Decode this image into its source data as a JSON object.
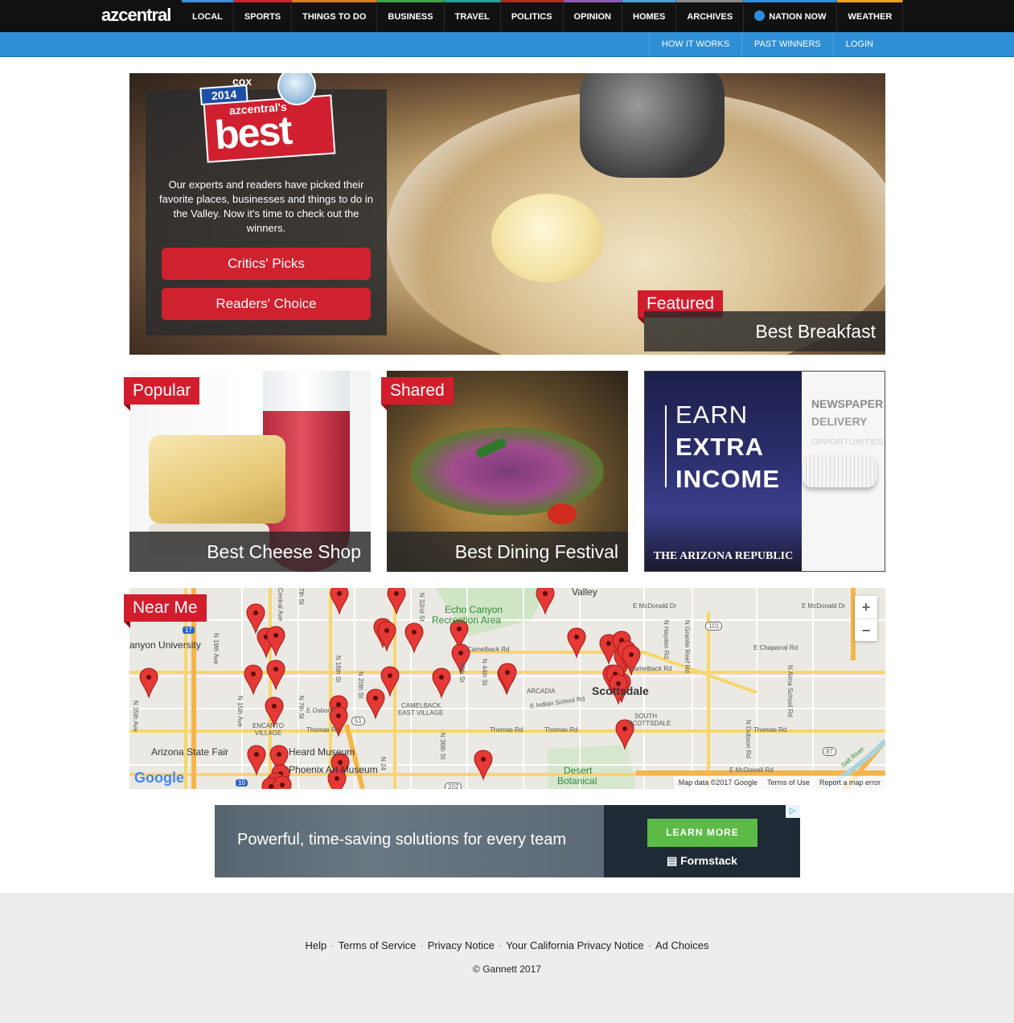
{
  "nav": {
    "logo": "azcentral",
    "items": [
      {
        "label": "LOCAL",
        "color": "#3a8fd8"
      },
      {
        "label": "SPORTS",
        "color": "#d0212f"
      },
      {
        "label": "THINGS TO DO",
        "color": "#e07a1f"
      },
      {
        "label": "BUSINESS",
        "color": "#3aa34a"
      },
      {
        "label": "TRAVEL",
        "color": "#1fa3a0"
      },
      {
        "label": "POLITICS",
        "color": "#b3281f"
      },
      {
        "label": "OPINION",
        "color": "#8a5db3"
      },
      {
        "label": "HOMES",
        "color": "#4aa3d8"
      },
      {
        "label": "ARCHIVES",
        "color": "#8a8a8a"
      },
      {
        "label": "NATION NOW",
        "color": "#2e8fe0"
      },
      {
        "label": "WEATHER",
        "color": "#f0a11f"
      }
    ]
  },
  "subnav": {
    "items": [
      "HOW IT WORKS",
      "PAST WINNERS",
      "LOGIN"
    ]
  },
  "hero": {
    "badge": {
      "sponsor": "cox",
      "year": "2014",
      "brand": "azcentral's",
      "title": "best"
    },
    "blurb": "Our experts and readers have picked their favorite places, businesses and things to do in the Valley. Now it's time to check out the winners.",
    "critics_button": "Critics' Picks",
    "readers_button": "Readers' Choice",
    "featured_tag": "Featured",
    "featured_caption": "Best Breakfast"
  },
  "tiles": {
    "popular_tag": "Popular",
    "popular_caption": "Best Cheese Shop",
    "shared_tag": "Shared",
    "shared_caption": "Best Dining Festival"
  },
  "ad_tile": {
    "line1": "EARN",
    "line2": "EXTRA",
    "line3": "INCOME",
    "publisher": "THE ARIZONA REPUBLIC",
    "side1": "NEWSPAPER",
    "side2": "DELIVERY",
    "side3": "OPPORTUNITIES"
  },
  "map": {
    "tag": "Near Me",
    "labels": {
      "valley": "Valley",
      "echo": "Echo Canyon",
      "recreation": "Recreation Area",
      "university": "anyon University",
      "camelback_village": "CAMELBACK",
      "camelback_village2": "EAST VILLAGE",
      "arcadia": "ARCADIA",
      "scottsdale": "Scottsdale",
      "south_scottsdale": "SOUTH",
      "south_scottsdale2": "SCOTTSDALE",
      "encanto": "ENCANTO",
      "encanto2": "VILLAGE",
      "state_fair": "Arizona State Fair",
      "heard": "Heard Museum",
      "phoenix_museum": "Phoenix Art Museum",
      "desert": "Desert",
      "botanical": "Botanical",
      "mcdonald1": "E McDonald Dr",
      "mcdonald2": "E McDonald Dr",
      "chaparral": "E Chaparral Rd",
      "camelback_rd": "Camelback Rd",
      "camelback_rd2": "Camelback Rd",
      "indian_school": "E Indian School Rd",
      "thomas1": "Thomas Rd",
      "thomas2": "Thomas Rd",
      "thomas3": "Thomas Rd",
      "thomas4": "Thomas Rd",
      "osborn": "E Osborn",
      "mcdowell": "E McDowell Rd",
      "salt_river": "Salt River",
      "s101": "101",
      "s51": "51",
      "s87": "87",
      "s17": "17",
      "s10": "10",
      "s202": "202",
      "n19": "N 19th Ave",
      "n15": "N 15th Ave",
      "n35": "N 35th Ave",
      "n16": "N 16th St",
      "n20": "N 20th St",
      "n32": "N 32nd St",
      "n36": "N 36th St",
      "n40": "40th St",
      "n44": "N 44th St",
      "n7": "7th St",
      "n7b": "N 7th St",
      "central": "Central Ave",
      "hayden": "N Hayden Rd",
      "granite": "N Granite Reef Rd",
      "alma": "N Alma School Rd",
      "dobson": "N Dobson Rd",
      "n24": "N 24"
    },
    "zoom_in": "+",
    "zoom_out": "−",
    "google": "Google",
    "footer": [
      "Map data ©2017 Google",
      "Terms of Use",
      "Report a map error"
    ]
  },
  "banner": {
    "headline": "Powerful, time-saving solutions for every team",
    "cta": "LEARN MORE",
    "brand": "Formstack",
    "adchoice": "▷"
  },
  "footer": {
    "links": [
      "Help",
      "Terms of Service",
      "Privacy Notice",
      "Your California Privacy Notice",
      "Ad Choices"
    ],
    "copyright": "© Gannett 2017"
  }
}
